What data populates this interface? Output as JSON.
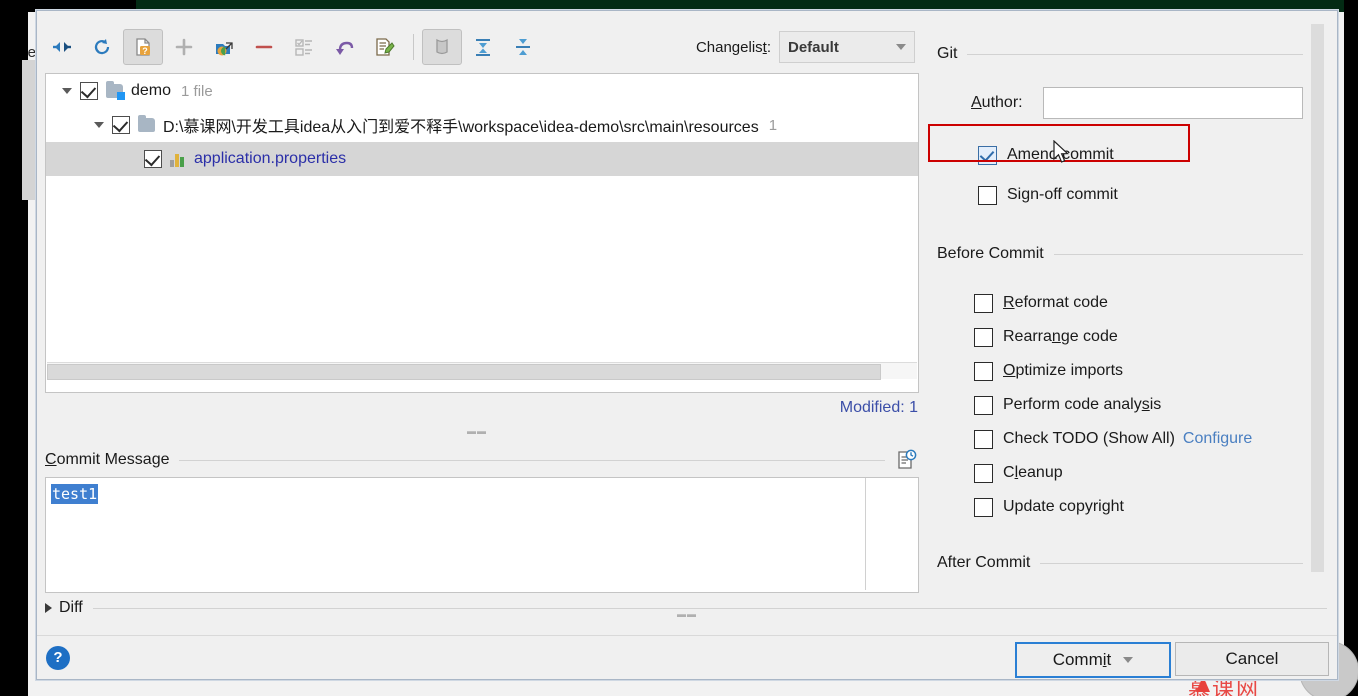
{
  "dialog": {
    "toolbar": {
      "icons": [
        {
          "name": "show-diff-icon",
          "pressed": false
        },
        {
          "name": "refresh-icon",
          "pressed": false
        },
        {
          "name": "unversioned-files-icon",
          "pressed": true
        },
        {
          "name": "add-icon",
          "pressed": false
        },
        {
          "name": "move-to-changelist-icon",
          "pressed": false
        },
        {
          "name": "delete-icon",
          "pressed": false
        },
        {
          "name": "group-by-icon",
          "pressed": false
        },
        {
          "name": "rollback-icon",
          "pressed": false
        },
        {
          "name": "edit-source-icon",
          "pressed": false
        },
        {
          "name": "show-ignored-icon",
          "pressed": true
        },
        {
          "name": "expand-all-icon",
          "pressed": false
        },
        {
          "name": "collapse-all-icon",
          "pressed": false
        }
      ],
      "changelist_label": "Changelist:",
      "changelist_mnemonic": "t",
      "changelist_value": "Default"
    },
    "tree": {
      "rows": [
        {
          "name": "demo",
          "meta": "1 file",
          "checked": true,
          "expanded": true,
          "kind": "folder-module",
          "indent": 0
        },
        {
          "name": "D:\\慕课网\\开发工具idea从入门到爱不释手\\workspace\\idea-demo\\src\\main\\resources",
          "meta": "1",
          "checked": true,
          "expanded": true,
          "kind": "folder",
          "indent": 1
        },
        {
          "name": "application.properties",
          "meta": "",
          "checked": true,
          "expanded": null,
          "kind": "file-properties",
          "indent": 2
        }
      ],
      "status": "Modified: 1"
    },
    "commit_message": {
      "label": "Commit Message",
      "mnemonic": "C",
      "value": "test1",
      "history_icon": "message-history-icon"
    },
    "diff": {
      "label": "Diff",
      "expanded": false
    },
    "footer": {
      "help_icon": "help-icon",
      "commit_label": "Commit",
      "commit_mnemonic": "i",
      "cancel_label": "Cancel"
    },
    "right_panel": {
      "git": {
        "title": "Git",
        "author_label": "Author:",
        "author_mnemonic": "A",
        "author_value": "",
        "checkboxes": [
          {
            "label": "Amend commit",
            "mnemonic": "m",
            "checked": true,
            "highlighted": true
          },
          {
            "label": "Sign-off commit",
            "mnemonic": "g",
            "checked": false,
            "highlighted": false
          }
        ]
      },
      "before_commit": {
        "title": "Before Commit",
        "checkboxes": [
          {
            "label": "Reformat code",
            "mnemonic": "R",
            "checked": false,
            "link": ""
          },
          {
            "label": "Rearrange code",
            "mnemonic": "n",
            "checked": false,
            "link": ""
          },
          {
            "label": "Optimize imports",
            "mnemonic": "O",
            "checked": false,
            "link": ""
          },
          {
            "label": "Perform code analysis",
            "mnemonic": "s",
            "checked": false,
            "link": ""
          },
          {
            "label": "Check TODO (Show All)",
            "mnemonic": "",
            "checked": false,
            "link": "Configure"
          },
          {
            "label": "Cleanup",
            "mnemonic": "l",
            "checked": false,
            "link": ""
          },
          {
            "label": "Update copyright",
            "mnemonic": "",
            "checked": false,
            "link": ""
          }
        ]
      },
      "after_commit": {
        "title": "After Commit"
      }
    }
  },
  "background": {
    "side_label": "e",
    "watermark": "慕课网",
    "play_icon": "play-button-icon"
  },
  "colors": {
    "accent_blue": "#2a7fd4",
    "link_blue": "#4a7fc1",
    "status_blue": "#3b4ea8",
    "highlight_red": "#cc0000",
    "selection_blue": "#3f7fd0",
    "dialog_bg": "#f0f0f0"
  }
}
